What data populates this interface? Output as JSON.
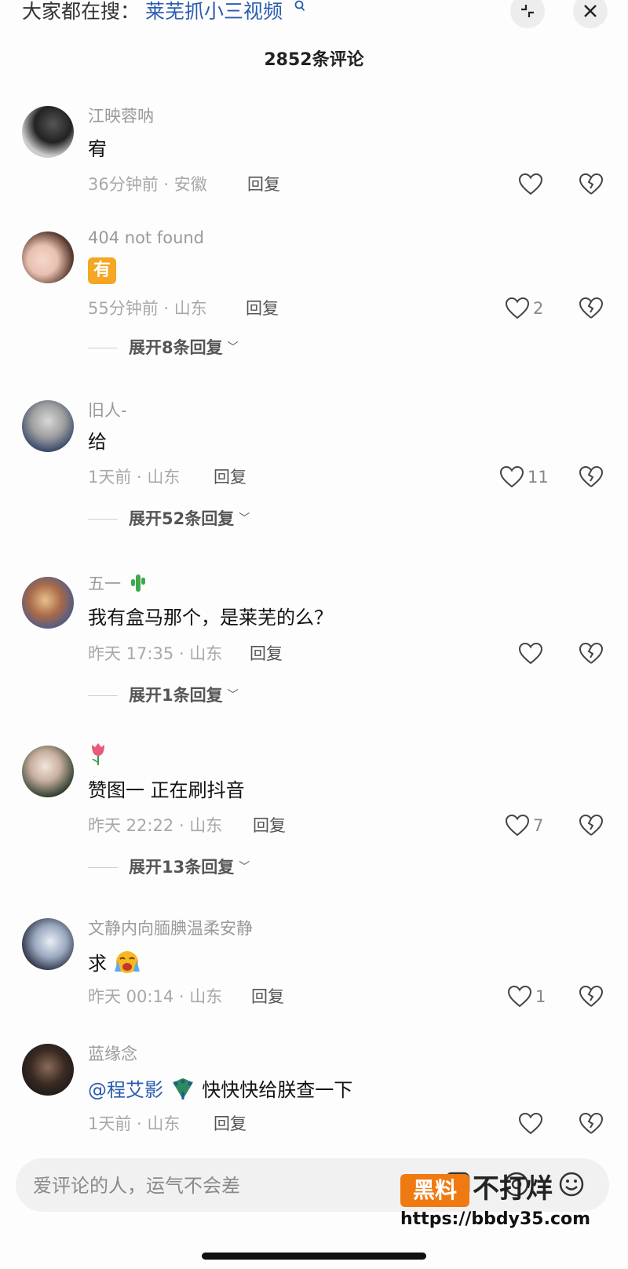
{
  "search": {
    "prefix": "大家都在搜：",
    "term": "莱芜抓小三视频"
  },
  "header": {
    "title": "2852条评论"
  },
  "comments": [
    {
      "username": "江映蓉呐",
      "text": "宥",
      "time_location": "36分钟前 · 安徽",
      "reply": "回复",
      "likes": ""
    },
    {
      "username": "404 not found",
      "text": "有",
      "time_location": "55分钟前 · 山东",
      "reply": "回复",
      "likes": "2",
      "expand": "展开8条回复"
    },
    {
      "username": "旧人-",
      "text": "给",
      "time_location": "1天前 · 山东",
      "reply": "回复",
      "likes": "11",
      "expand": "展开52条回复"
    },
    {
      "username": "五一",
      "text": "我有盒马那个，是莱芜的么？",
      "time_location": "昨天 17:35 · 山东",
      "reply": "回复",
      "likes": "",
      "expand": "展开1条回复"
    },
    {
      "username": "",
      "text": "赞图一  正在刷抖音",
      "time_location": "昨天 22:22 · 山东",
      "reply": "回复",
      "likes": "7",
      "expand": "展开13条回复"
    },
    {
      "username": "文静内向腼腆温柔安静",
      "text": "求",
      "time_location": "昨天 00:14 · 山东",
      "reply": "回复",
      "likes": "1"
    },
    {
      "username": "蓝缘念",
      "mention": "@程艾影",
      "text": "快快快给朕查一下",
      "time_location": "1天前 · 山东",
      "reply": "回复",
      "likes": ""
    }
  ],
  "input": {
    "placeholder": "爱评论的人，运气不会差"
  },
  "watermark": {
    "box": "黑料",
    "text": "不打烊",
    "url": "https://bbdy35.com"
  },
  "colors": {
    "link": "#2a5db0",
    "accent": "#f07a12",
    "badge": "#f5a623"
  }
}
